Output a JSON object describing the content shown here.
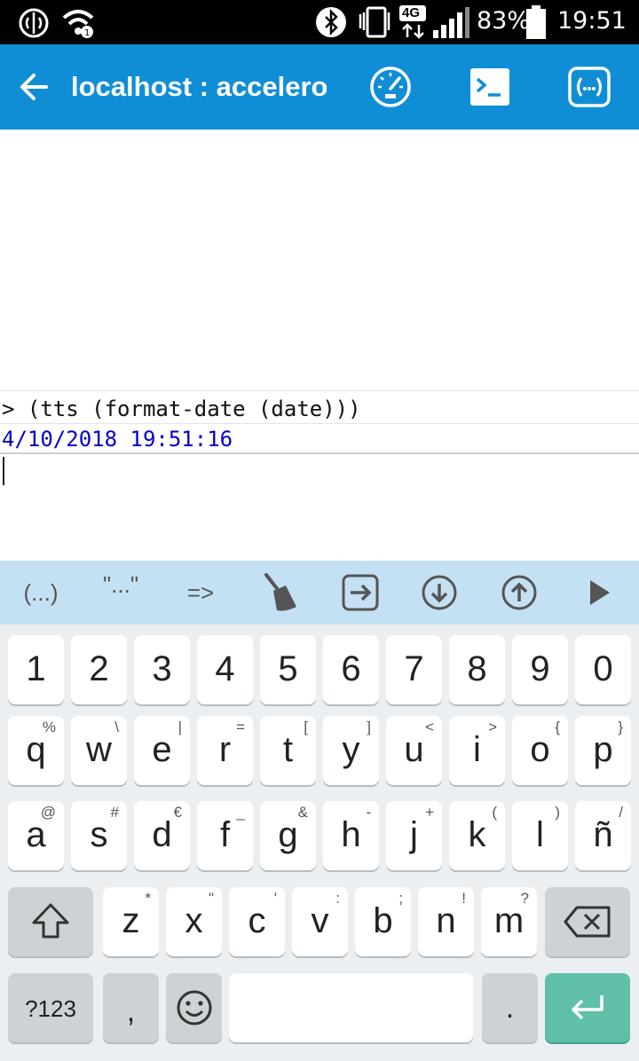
{
  "status_bar": {
    "network_type": "4G",
    "battery_percent": "83%",
    "time": "19:51"
  },
  "app_bar": {
    "title": "localhost : accelerometer",
    "icons": [
      "back-arrow-icon",
      "speedometer-icon",
      "terminal-icon",
      "snippets-icon"
    ]
  },
  "console": {
    "command": "> (tts (format-date (date)))",
    "result": "4/10/2018 19:51:16"
  },
  "toolbar": {
    "parens_label": "(...)",
    "quotes_label": "\"...\"",
    "arrow_label": "=>",
    "icons": [
      "parentheses-icon",
      "quotes-icon",
      "arrow-icon",
      "broom-icon",
      "tab-icon",
      "down-circle-icon",
      "up-circle-icon",
      "play-icon"
    ]
  },
  "keyboard": {
    "row1": [
      "1",
      "2",
      "3",
      "4",
      "5",
      "6",
      "7",
      "8",
      "9",
      "0"
    ],
    "row2": [
      {
        "key": "q",
        "hint": "%"
      },
      {
        "key": "w",
        "hint": "\\"
      },
      {
        "key": "e",
        "hint": "|"
      },
      {
        "key": "r",
        "hint": "="
      },
      {
        "key": "t",
        "hint": "["
      },
      {
        "key": "y",
        "hint": "]"
      },
      {
        "key": "u",
        "hint": "<"
      },
      {
        "key": "i",
        "hint": ">"
      },
      {
        "key": "o",
        "hint": "{"
      },
      {
        "key": "p",
        "hint": "}"
      }
    ],
    "row3": [
      {
        "key": "a",
        "hint": "@"
      },
      {
        "key": "s",
        "hint": "#"
      },
      {
        "key": "d",
        "hint": "€"
      },
      {
        "key": "f",
        "hint": "_"
      },
      {
        "key": "g",
        "hint": "&"
      },
      {
        "key": "h",
        "hint": "-"
      },
      {
        "key": "j",
        "hint": "+"
      },
      {
        "key": "k",
        "hint": "("
      },
      {
        "key": "l",
        "hint": ")"
      },
      {
        "key": "ñ",
        "hint": "/"
      }
    ],
    "row4": [
      {
        "key": "z",
        "hint": "*"
      },
      {
        "key": "x",
        "hint": "\""
      },
      {
        "key": "c",
        "hint": "'"
      },
      {
        "key": "v",
        "hint": ":"
      },
      {
        "key": "b",
        "hint": ";"
      },
      {
        "key": "n",
        "hint": "!"
      },
      {
        "key": "m",
        "hint": "?"
      }
    ],
    "symbols_label": "?123",
    "comma_label": ",",
    "period_label": "."
  },
  "colors": {
    "app_bar": "#0f8ed6",
    "toolbar": "#c3e1f3",
    "enter_key": "#5fbfa9",
    "result_text": "#0000cc"
  }
}
